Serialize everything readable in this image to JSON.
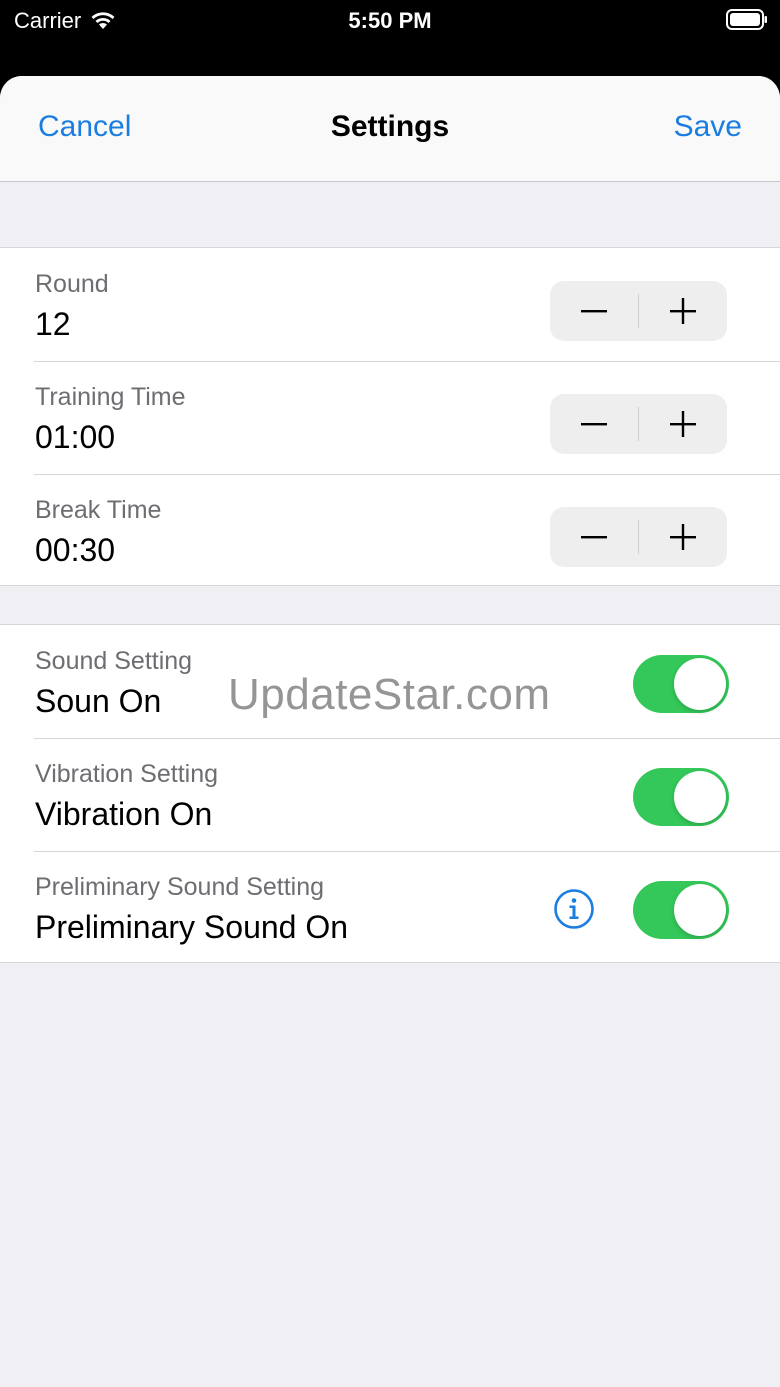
{
  "status_bar": {
    "carrier": "Carrier",
    "time": "5:50 PM",
    "wifi_icon": "wifi-icon",
    "battery_icon": "battery-icon"
  },
  "navbar": {
    "cancel_label": "Cancel",
    "title": "Settings",
    "save_label": "Save"
  },
  "timer_settings": [
    {
      "label": "Round",
      "value": "12"
    },
    {
      "label": "Training Time",
      "value": "01:00"
    },
    {
      "label": "Break Time",
      "value": "00:30"
    }
  ],
  "feedback_settings": [
    {
      "label": "Sound Setting",
      "value": "Soun On",
      "enabled": true
    },
    {
      "label": "Vibration Setting",
      "value": "Vibration On",
      "enabled": true
    },
    {
      "label": "Preliminary Sound Setting",
      "value": "Preliminary Sound On",
      "enabled": true,
      "info_icon": "info-icon"
    }
  ],
  "watermark": "UpdateStar.com",
  "colors": {
    "accent": "#1a7ee0",
    "toggle_on": "#34c759",
    "background": "#efeff4"
  }
}
